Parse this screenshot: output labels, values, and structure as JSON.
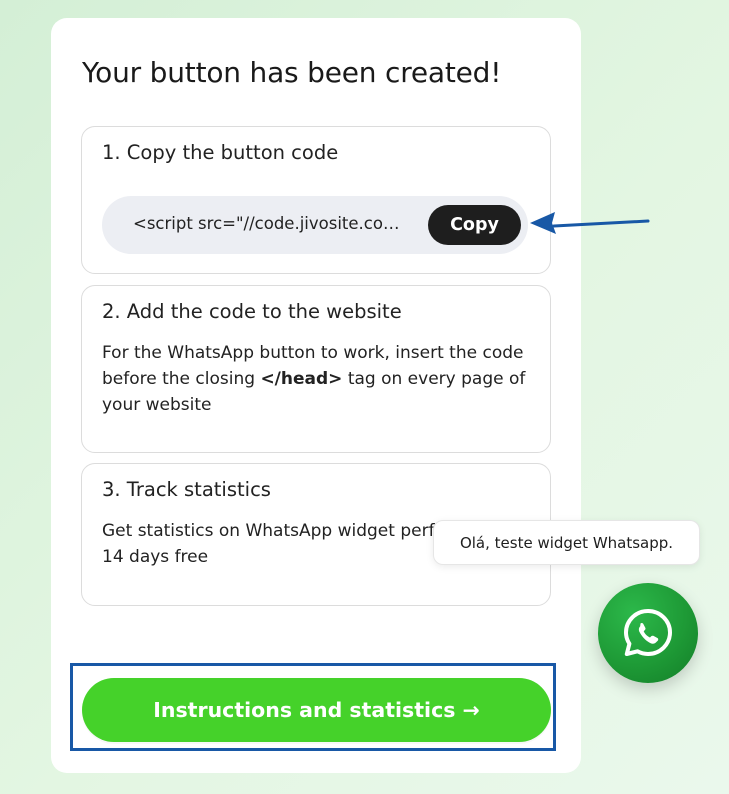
{
  "card": {
    "title": "Your button has been created!"
  },
  "steps": {
    "copy": {
      "heading": "1. Copy the button code",
      "code": "<script src=\"//code.jivosite.co…",
      "copy_label": "Copy"
    },
    "add": {
      "heading": "2. Add the code to the website",
      "text_before": "For the WhatsApp button to work, insert the code before the closing ",
      "tag": "</head>",
      "text_after": " tag on every page of your website"
    },
    "track": {
      "heading": "3. Track statistics",
      "text": "Get statistics on WhatsApp widget performance. 14 days free"
    }
  },
  "cta": {
    "label": "Instructions and statistics →"
  },
  "widget": {
    "bubble_text": "Olá, teste widget Whatsapp.",
    "icon": "whatsapp-icon"
  },
  "colors": {
    "cta_green": "#45d22a",
    "whatsapp_green": "#1e9a36",
    "annotation_blue": "#1858a6",
    "copy_button": "#1e1e1e"
  }
}
